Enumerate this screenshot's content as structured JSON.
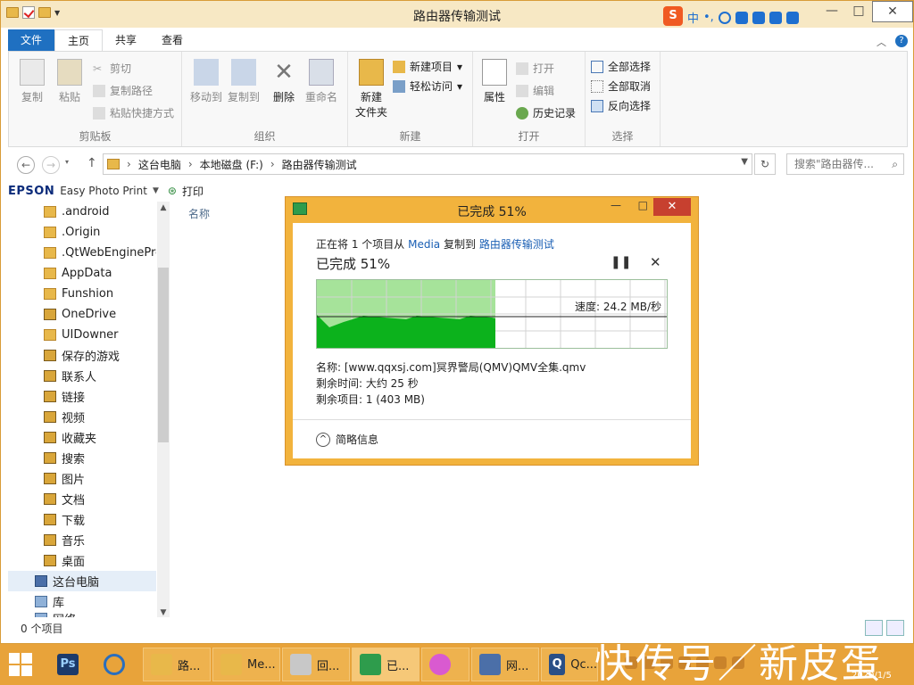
{
  "window": {
    "title": "路由器传输测试",
    "controls": {
      "minimize": "—",
      "maximize": "□",
      "close": "✕"
    }
  },
  "ime": {
    "logo": "S",
    "lang": "中",
    "punct": "•,"
  },
  "ribbon": {
    "tabs": [
      "文件",
      "主页",
      "共享",
      "查看"
    ],
    "groups": {
      "clipboard": {
        "label": "剪贴板",
        "copy": "复制",
        "paste": "粘贴",
        "cut": "剪切",
        "copy_path": "复制路径",
        "paste_shortcut": "粘贴快捷方式"
      },
      "organize": {
        "label": "组织",
        "move_to": "移动到",
        "copy_to": "复制到",
        "delete": "删除",
        "rename": "重命名"
      },
      "new": {
        "label": "新建",
        "new_folder_line1": "新建",
        "new_folder_line2": "文件夹",
        "new_item": "新建项目",
        "easy_access": "轻松访问"
      },
      "open": {
        "label": "打开",
        "properties": "属性",
        "open": "打开",
        "edit": "编辑",
        "history": "历史记录"
      },
      "select": {
        "label": "选择",
        "select_all": "全部选择",
        "select_none": "全部取消",
        "invert": "反向选择"
      }
    }
  },
  "address": {
    "back": "←",
    "forward": "→",
    "up": "↑",
    "crumbs": [
      "这台电脑",
      "本地磁盘 (F:)",
      "路由器传输测试"
    ],
    "search_placeholder": "搜索\"路由器传..."
  },
  "cmdbar": {
    "brand": "EPSON",
    "app": "Easy Photo Print",
    "print": "打印"
  },
  "nav": {
    "items": [
      ".android",
      ".Origin",
      ".QtWebEngineProc",
      "AppData",
      "Funshion",
      "OneDrive",
      "UIDowner",
      "保存的游戏",
      "联系人",
      "链接",
      "视频",
      "收藏夹",
      "搜索",
      "图片",
      "文档",
      "下载",
      "音乐",
      "桌面"
    ],
    "this_pc": "这台电脑",
    "library": "库",
    "network": "网络"
  },
  "content": {
    "column_name": "名称"
  },
  "status": {
    "items": "0 个项目"
  },
  "dialog": {
    "title": "已完成 51%",
    "line_prefix": "正在将 1 个项目从",
    "source": "Media",
    "line_mid": "复制到",
    "dest": "路由器传输测试",
    "progress_text": "已完成 51%",
    "progress": 0.51,
    "speed": "速度: 24.2 MB/秒",
    "name": "名称: [www.qqxsj.com]冥界警局(QMV)QMV全集.qmv",
    "time_left": "剩余时间: 大约 25 秒",
    "items_left": "剩余项目: 1 (403 MB)",
    "less_info": "简略信息",
    "pause": "❚❚",
    "cancel": "✕"
  },
  "taskbar": {
    "buttons": [
      "路...",
      "Me...",
      "回...",
      "已...",
      "",
      "网...",
      "Qc..."
    ]
  },
  "tray": {
    "date": "2020/1/5"
  },
  "watermark": "快传号／新皮蛋",
  "colors": {
    "accent": "#1f70c1",
    "taskbar": "#e8a33a",
    "graph_fill": "#0cb21c",
    "graph_bg": "#a6e39a",
    "close": "#c7402f"
  }
}
